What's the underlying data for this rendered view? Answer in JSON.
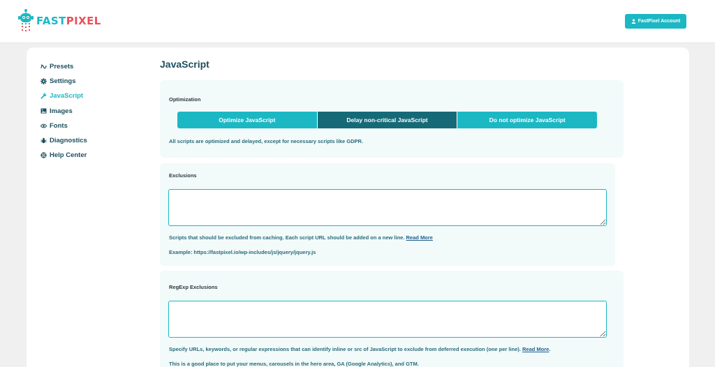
{
  "brand": {
    "name_part1": "FAST",
    "name_part2": "PIXEL"
  },
  "header": {
    "account_button_label": "FastPixel Account",
    "account_icon": "user-icon"
  },
  "sidebar": {
    "items": [
      {
        "label": "Presets",
        "icon": "presets-icon"
      },
      {
        "label": "Settings",
        "icon": "gear-icon"
      },
      {
        "label": "JavaScript",
        "icon": "wrench-icon",
        "active": true
      },
      {
        "label": "Images",
        "icon": "image-icon"
      },
      {
        "label": "Fonts",
        "icon": "eye-icon"
      },
      {
        "label": "Diagnostics",
        "icon": "bug-icon"
      },
      {
        "label": "Help Center",
        "icon": "lifebuoy-icon"
      }
    ]
  },
  "main": {
    "title": "JavaScript",
    "optimization": {
      "label": "Optimization",
      "options": [
        "Optimize JavaScript",
        "Delay non-critical JavaScript",
        "Do not optimize JavaScript"
      ],
      "selected": "Delay non-critical JavaScript",
      "description": "All scripts are optimized and delayed, except for necessary scripts like GDPR."
    },
    "exclusions": {
      "label": "Exclusions",
      "value": "",
      "help_text": "Scripts that should be excluded from caching. Each script URL should be added on a new line.",
      "read_more": "Read More",
      "example": "Example: https://fastpixel.io/wp-includes/js/jquery/jquery.js"
    },
    "regexp_exclusions": {
      "label": "RegExp Exclusions",
      "value": "",
      "help_text": "Specify URLs, keywords, or regular expressions that can identify inline or src of JavaScript to exclude from deferred execution (one per line).",
      "read_more": "Read More",
      "tip": "This is a good place to put your menus, carousels in the hero area, GA (Google Analytics), and GTM."
    }
  },
  "colors": {
    "accent": "#1bb8c4",
    "selected": "#166a78",
    "brand_red": "#e8505b",
    "text": "#1d4f5e",
    "panel_bg": "#f2fafa"
  }
}
